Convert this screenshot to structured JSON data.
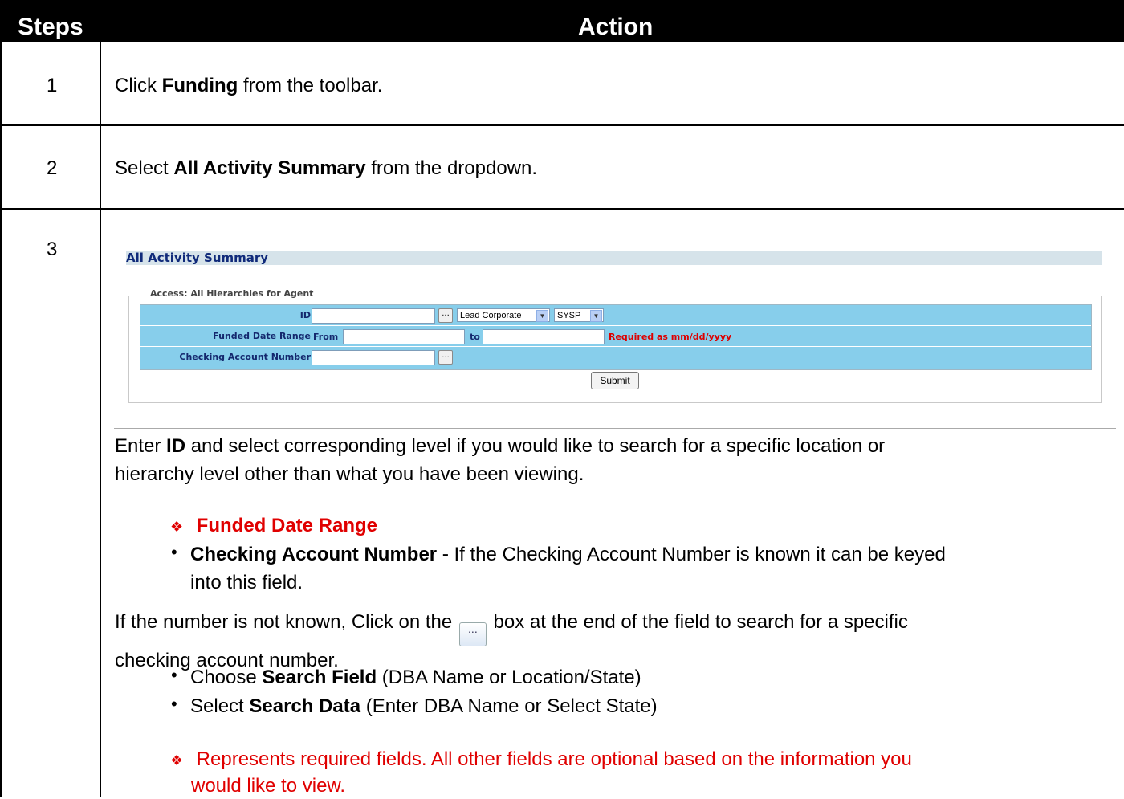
{
  "header": {
    "steps_label": "Steps",
    "action_label": "Action"
  },
  "rows": [
    {
      "num": "1",
      "pre": "Click ",
      "bold": "Funding",
      "post": " from the toolbar."
    },
    {
      "num": "2",
      "pre": "Select ",
      "bold": "All Activity Summary",
      "post": " from the dropdown."
    },
    {
      "num": "3"
    }
  ],
  "screenshot": {
    "title": "All Activity Summary",
    "legend": "Access: All Hierarchies for Agent",
    "id_label": "ID",
    "level_select": "Lead Corporate",
    "sys_select": "SYSP",
    "funded_label": "Funded Date Range",
    "from_label": "From",
    "to_label": "to",
    "required_text": "Required as mm/dd/yyyy",
    "checking_label": "Checking Account Number",
    "submit_label": "Submit",
    "ellipsis": "..."
  },
  "instructions": {
    "enter_pre": "Enter ",
    "enter_bold": "ID",
    "enter_line1": " and select corresponding level if you would like to search for a specific location or",
    "enter_line2": "hierarchy level other than what you have been viewing.",
    "funded_bold": "Funded Date Range",
    "checking_bold": "Checking Account Number - ",
    "checking_line1": "If the Checking Account Number is known it can be keyed",
    "checking_line2": "into this field.",
    "if_pre": "If the number is not known, Click on the ",
    "if_post": " box at the end of the field to search for a specific",
    "if_line2": "checking account number.",
    "choose_pre": "Choose ",
    "choose_bold": "Search Field",
    "choose_post": " (DBA Name or Location/State)",
    "select_pre": "Select ",
    "select_bold": "Search Data",
    "select_post": " (Enter DBA Name or Select State)",
    "req_line1": "Represents required fields. All other fields are optional based on the information you",
    "req_line2": "would like to view."
  },
  "icons": {
    "diamond": "❖",
    "bullet": "•"
  }
}
